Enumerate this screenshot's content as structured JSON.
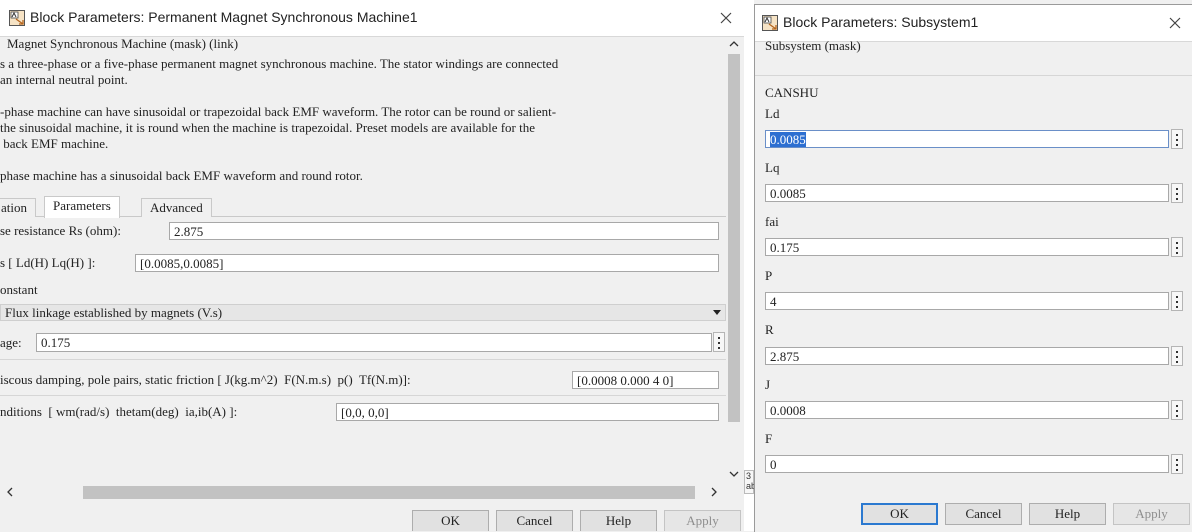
{
  "left": {
    "title": "Block Parameters: Permanent Magnet Synchronous Machine1",
    "header": "Magnet Synchronous Machine (mask) (link)",
    "desc_lines": [
      "s a three-phase or a five-phase permanent magnet synchronous machine. The stator windings are connected",
      "an internal neutral point.",
      "",
      "-phase machine can have sinusoidal or trapezoidal back EMF waveform. The rotor can be round or salient-",
      "the sinusoidal machine, it is round when the machine is trapezoidal. Preset models are available for the",
      " back EMF machine.",
      "",
      "phase machine has a sinusoidal back EMF waveform and round rotor."
    ],
    "tabs": [
      "ation",
      "Parameters",
      "Advanced"
    ],
    "params": {
      "rs_label": "se resistance Rs (ohm):",
      "rs_value": "2.875",
      "ldlq_label": "s [ Ld(H) Lq(H) ]:",
      "ldlq_value": "[0.0085,0.0085]",
      "constant_label": "onstant",
      "flux_select": "Flux linkage established by magnets (V.s)",
      "flux_label": "age:",
      "flux_value": "0.175",
      "inertia_label": "iscous damping, pole pairs, static friction [ J(kg.m^2)  F(N.m.s)  p()  Tf(N.m)]:",
      "inertia_value": "[0.0008 0.000 4 0]",
      "init_label": "nditions  [ wm(rad/s)  thetam(deg)  ia,ib(A) ]:",
      "init_value": "[0,0, 0,0]"
    },
    "buttons": {
      "ok": "OK",
      "cancel": "Cancel",
      "help": "Help",
      "apply": "Apply"
    }
  },
  "gap_fragment": {
    "line1": "3",
    "line2": "ab"
  },
  "right": {
    "title": "Block Parameters: Subsystem1",
    "header": "Subsystem (mask)",
    "group": "CANSHU",
    "fields": [
      {
        "label": "Ld",
        "value": "0.0085"
      },
      {
        "label": "Lq",
        "value": "0.0085"
      },
      {
        "label": "fai",
        "value": "0.175"
      },
      {
        "label": "P",
        "value": "4"
      },
      {
        "label": "R",
        "value": "2.875"
      },
      {
        "label": "J",
        "value": "0.0008"
      },
      {
        "label": "F",
        "value": "0"
      }
    ],
    "buttons": {
      "ok": "OK",
      "cancel": "Cancel",
      "help": "Help",
      "apply": "Apply"
    }
  },
  "icons": {
    "block": "simulink-block-icon",
    "close": "close-icon",
    "more": "more-options-icon",
    "dropdown": "chevron-down-icon"
  },
  "colors": {
    "selection": "#2d6fd1",
    "default_button_border": "#2b79d0"
  }
}
